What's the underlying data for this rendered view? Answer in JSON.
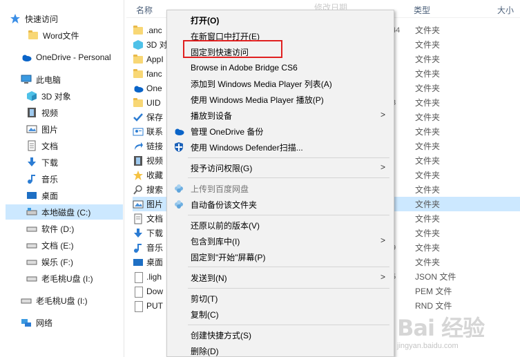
{
  "nav": {
    "items": [
      {
        "label": "快速访问",
        "icon": "star-icon"
      },
      {
        "label": "Word文件",
        "icon": "folder-icon"
      },
      {
        "label": "OneDrive - Personal",
        "icon": "cloud-icon"
      },
      {
        "label": "此电脑",
        "icon": "computer-icon"
      },
      {
        "label": "3D 对象",
        "icon": "cube-icon"
      },
      {
        "label": "视频",
        "icon": "film-icon"
      },
      {
        "label": "图片",
        "icon": "picture-icon"
      },
      {
        "label": "文档",
        "icon": "document-icon"
      },
      {
        "label": "下载",
        "icon": "download-icon"
      },
      {
        "label": "音乐",
        "icon": "music-icon"
      },
      {
        "label": "桌面",
        "icon": "desktop-icon"
      },
      {
        "label": "本地磁盘 (C:)",
        "icon": "drive-icon"
      },
      {
        "label": "软件 (D:)",
        "icon": "drive-icon"
      },
      {
        "label": "文档 (E:)",
        "icon": "drive-icon"
      },
      {
        "label": "娱乐 (F:)",
        "icon": "drive-icon"
      },
      {
        "label": "老毛桃U盘 (I:)",
        "icon": "usb-drive-icon"
      },
      {
        "label": "老毛桃U盘 (I:)",
        "icon": "usb-drive-icon"
      },
      {
        "label": "网络",
        "icon": "network-icon"
      }
    ]
  },
  "headers": {
    "name": "名称",
    "modified": "修改日期",
    "type": "类型",
    "size": "大小"
  },
  "files": [
    {
      "name": ".anc",
      "trail": "44",
      "type": "文件夹",
      "icon": "folder-icon"
    },
    {
      "name": "3D 对",
      "trail": "",
      "type": "文件夹",
      "icon": "cube-icon"
    },
    {
      "name": "AppI",
      "trail": "",
      "type": "文件夹",
      "icon": "folder-icon"
    },
    {
      "name": "fanc",
      "trail": "",
      "type": "文件夹",
      "icon": "folder-icon"
    },
    {
      "name": "One",
      "trail": "",
      "type": "文件夹",
      "icon": "cloud-icon"
    },
    {
      "name": "UID",
      "trail": "3",
      "type": "文件夹",
      "icon": "folder-icon"
    },
    {
      "name": "保存",
      "trail": "",
      "type": "文件夹",
      "icon": "save-icon"
    },
    {
      "name": "联系",
      "trail": "",
      "type": "文件夹",
      "icon": "contacts-icon"
    },
    {
      "name": "链接",
      "trail": "",
      "type": "文件夹",
      "icon": "link-icon"
    },
    {
      "name": "视频",
      "trail": "",
      "type": "文件夹",
      "icon": "film-icon"
    },
    {
      "name": "收藏",
      "trail": "",
      "type": "文件夹",
      "icon": "star-icon"
    },
    {
      "name": "搜索",
      "trail": "",
      "type": "文件夹",
      "icon": "search-icon"
    },
    {
      "name": "图片",
      "trail": "",
      "type": "文件夹",
      "icon": "picture-icon"
    },
    {
      "name": "文档",
      "trail": "",
      "type": "文件夹",
      "icon": "document-icon"
    },
    {
      "name": "下载",
      "trail": "",
      "type": "文件夹",
      "icon": "download-icon"
    },
    {
      "name": "音乐",
      "trail": "9",
      "type": "文件夹",
      "icon": "music-icon"
    },
    {
      "name": "桌面",
      "trail": "",
      "type": "文件夹",
      "icon": "desktop-icon"
    },
    {
      "name": ".ligh",
      "trail": "5",
      "type": "JSON 文件",
      "icon": "file-icon"
    },
    {
      "name": "Dow",
      "trail": "",
      "type": "PEM 文件",
      "icon": "file-icon"
    },
    {
      "name": "PUT",
      "trail": "",
      "type": "RND 文件",
      "icon": "file-icon"
    }
  ],
  "menu": {
    "items": [
      {
        "label": "打开(O)",
        "bold": true
      },
      {
        "label": "在新窗口中打开(E)"
      },
      {
        "label": "固定到快速访问"
      },
      {
        "label": "Browse in Adobe Bridge CS6"
      },
      {
        "label": "添加到 Windows Media Player 列表(A)"
      },
      {
        "label": "使用 Windows Media Player 播放(P)"
      },
      {
        "label": "播放到设备",
        "submenu": true
      },
      {
        "label": "管理 OneDrive 备份",
        "icon": "onedrive-icon"
      },
      {
        "label": "使用 Windows Defender扫描...",
        "icon": "defender-shield-icon"
      },
      {
        "label": "授予访问权限(G)",
        "submenu": true
      },
      {
        "label": "上传到百度网盘",
        "icon": "baidu-cloud-icon"
      },
      {
        "label": "自动备份该文件夹",
        "icon": "baidu-cloud-icon"
      },
      {
        "label": "还原以前的版本(V)"
      },
      {
        "label": "包含到库中(I)",
        "submenu": true
      },
      {
        "label": "固定到\"开始\"屏幕(P)"
      },
      {
        "label": "发送到(N)",
        "submenu": true
      },
      {
        "label": "剪切(T)"
      },
      {
        "label": "复制(C)"
      },
      {
        "label": "创建快捷方式(S)"
      },
      {
        "label": "删除(D)"
      }
    ]
  },
  "watermark": {
    "brand": "Bai 经验",
    "url": "jingyan.baidu.com"
  },
  "colors": {
    "selection": "#cce8ff",
    "highlight_box": "#e02020",
    "folder": "#f8d775"
  }
}
